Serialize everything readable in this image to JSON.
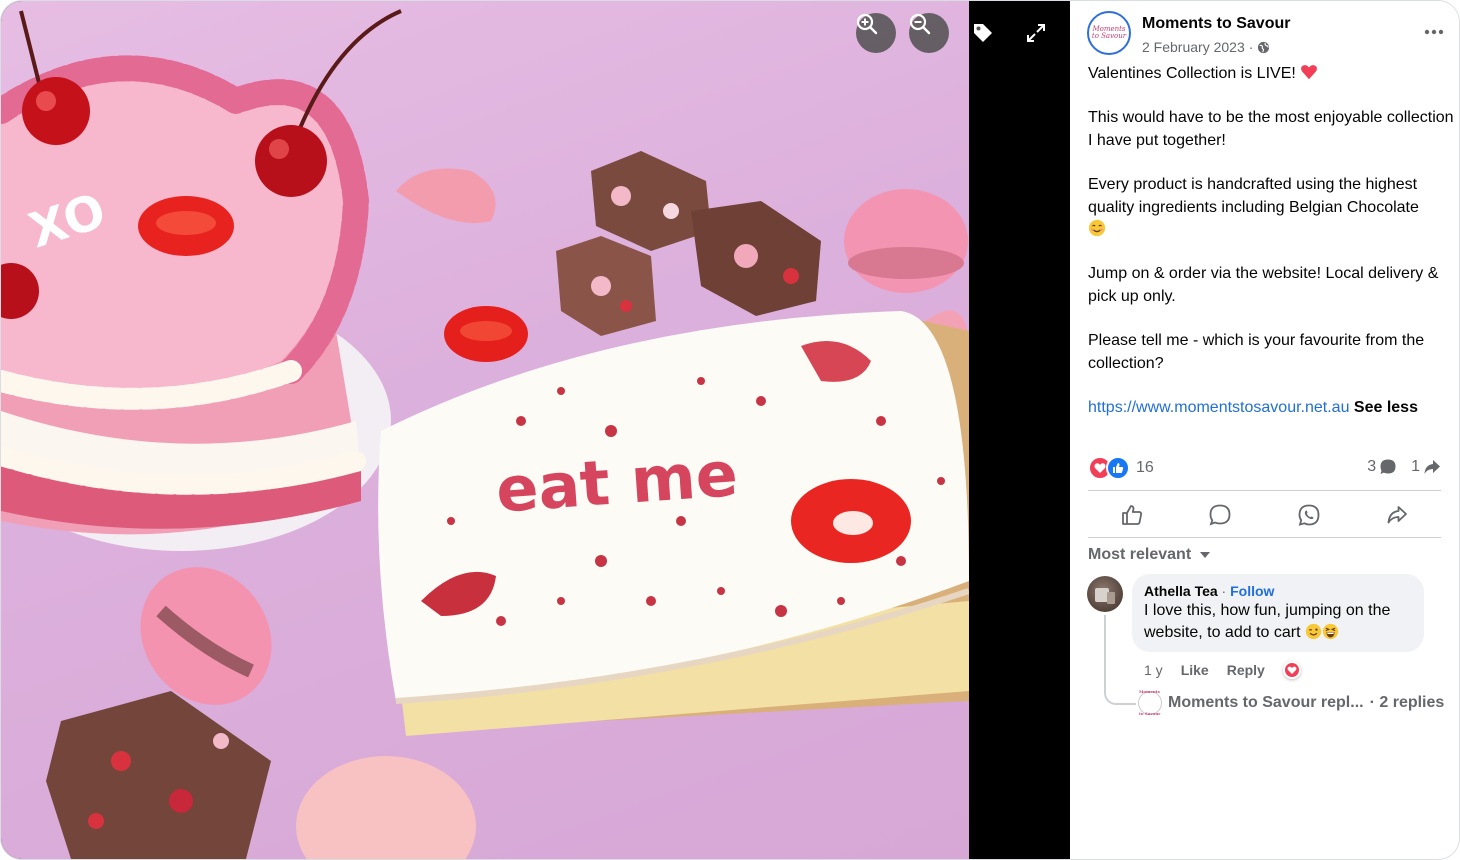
{
  "viewer": {
    "zoom_in_icon": "zoom-in-icon",
    "zoom_out_icon": "zoom-out-icon",
    "tag_icon": "tag-icon",
    "fullscreen_icon": "expand-icon",
    "cake_text_1": "XO",
    "cake_text_2": "eat me"
  },
  "post": {
    "page_name": "Moments to Savour",
    "date": "2 February 2023",
    "privacy_icon": "globe-icon",
    "avatar_logo": "Moments to Savour",
    "paragraphs": [
      "Valentines Collection is LIVE!",
      "This would have to be the most enjoyable collection I have put together!",
      "Every product is handcrafted using the highest quality ingredients including Belgian Chocolate",
      "Jump on & order via the website! Local delivery & pick up only.",
      "Please tell me - which is your favourite from the collection?"
    ],
    "link": "https://www.momentstosavour.net.au",
    "see_less": "See less"
  },
  "stats": {
    "reaction_count": "16",
    "comment_count": "3",
    "share_count": "1"
  },
  "actions": [
    "like-icon",
    "comment-icon",
    "whatsapp-icon",
    "share-icon"
  ],
  "comments": {
    "sort_label": "Most relevant",
    "items": [
      {
        "author": "Athella Tea",
        "follow": "Follow",
        "text": "I love this, how fun, jumping on the website, to add to cart",
        "time": "1 y",
        "like": "Like",
        "reply": "Reply"
      }
    ],
    "reply_summary": "Moments to Savour repl...",
    "reply_count": "· 2 replies"
  },
  "colors": {
    "accent_blue": "#216fdb",
    "love_red": "#f33e58",
    "muted": "#65676b"
  }
}
